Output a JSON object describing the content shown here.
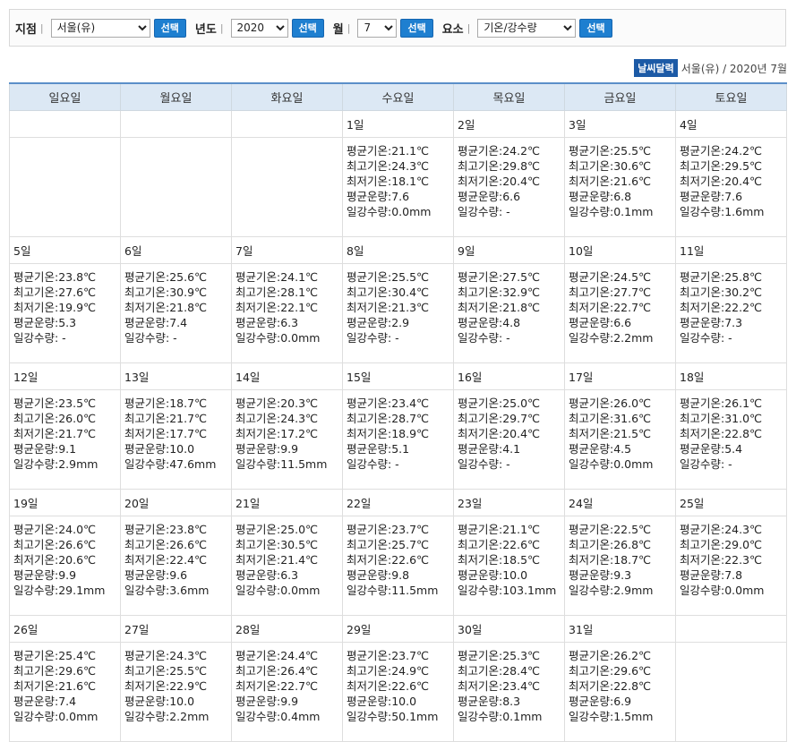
{
  "filters": {
    "station_label": "지점",
    "station_value": "서울(유)",
    "year_label": "년도",
    "year_value": "2020",
    "month_label": "월",
    "month_value": "7",
    "element_label": "요소",
    "element_value": "기온/강수량",
    "select_button": "선택"
  },
  "caption": {
    "badge": "날씨달력",
    "text": "서울(유) / 2020년 7월"
  },
  "calendar": {
    "weekdays": [
      "일요일",
      "월요일",
      "화요일",
      "수요일",
      "목요일",
      "금요일",
      "토요일"
    ],
    "weeks": [
      [
        null,
        null,
        null,
        {
          "day": "1일",
          "avg_temp": "평균기온:21.1℃",
          "max_temp": "최고기온:24.3℃",
          "min_temp": "최저기온:18.1℃",
          "cloud": "평균운량:7.6",
          "rain": "일강수량:0.0mm"
        },
        {
          "day": "2일",
          "avg_temp": "평균기온:24.2℃",
          "max_temp": "최고기온:29.8℃",
          "min_temp": "최저기온:20.4℃",
          "cloud": "평균운량:6.6",
          "rain": "일강수량: -"
        },
        {
          "day": "3일",
          "avg_temp": "평균기온:25.5℃",
          "max_temp": "최고기온:30.6℃",
          "min_temp": "최저기온:21.6℃",
          "cloud": "평균운량:6.8",
          "rain": "일강수량:0.1mm"
        },
        {
          "day": "4일",
          "avg_temp": "평균기온:24.2℃",
          "max_temp": "최고기온:29.5℃",
          "min_temp": "최저기온:20.4℃",
          "cloud": "평균운량:7.6",
          "rain": "일강수량:1.6mm"
        }
      ],
      [
        {
          "day": "5일",
          "avg_temp": "평균기온:23.8℃",
          "max_temp": "최고기온:27.6℃",
          "min_temp": "최저기온:19.9℃",
          "cloud": "평균운량:5.3",
          "rain": "일강수량: -"
        },
        {
          "day": "6일",
          "avg_temp": "평균기온:25.6℃",
          "max_temp": "최고기온:30.9℃",
          "min_temp": "최저기온:21.8℃",
          "cloud": "평균운량:7.4",
          "rain": "일강수량: -"
        },
        {
          "day": "7일",
          "avg_temp": "평균기온:24.1℃",
          "max_temp": "최고기온:28.1℃",
          "min_temp": "최저기온:22.1℃",
          "cloud": "평균운량:6.3",
          "rain": "일강수량:0.0mm"
        },
        {
          "day": "8일",
          "avg_temp": "평균기온:25.5℃",
          "max_temp": "최고기온:30.4℃",
          "min_temp": "최저기온:21.3℃",
          "cloud": "평균운량:2.9",
          "rain": "일강수량: -"
        },
        {
          "day": "9일",
          "avg_temp": "평균기온:27.5℃",
          "max_temp": "최고기온:32.9℃",
          "min_temp": "최저기온:21.8℃",
          "cloud": "평균운량:4.8",
          "rain": "일강수량: -"
        },
        {
          "day": "10일",
          "avg_temp": "평균기온:24.5℃",
          "max_temp": "최고기온:27.7℃",
          "min_temp": "최저기온:22.7℃",
          "cloud": "평균운량:6.6",
          "rain": "일강수량:2.2mm"
        },
        {
          "day": "11일",
          "avg_temp": "평균기온:25.8℃",
          "max_temp": "최고기온:30.2℃",
          "min_temp": "최저기온:22.2℃",
          "cloud": "평균운량:7.3",
          "rain": "일강수량: -"
        }
      ],
      [
        {
          "day": "12일",
          "avg_temp": "평균기온:23.5℃",
          "max_temp": "최고기온:26.0℃",
          "min_temp": "최저기온:21.7℃",
          "cloud": "평균운량:9.1",
          "rain": "일강수량:2.9mm"
        },
        {
          "day": "13일",
          "avg_temp": "평균기온:18.7℃",
          "max_temp": "최고기온:21.7℃",
          "min_temp": "최저기온:17.7℃",
          "cloud": "평균운량:10.0",
          "rain": "일강수량:47.6mm"
        },
        {
          "day": "14일",
          "avg_temp": "평균기온:20.3℃",
          "max_temp": "최고기온:24.3℃",
          "min_temp": "최저기온:17.2℃",
          "cloud": "평균운량:9.9",
          "rain": "일강수량:11.5mm"
        },
        {
          "day": "15일",
          "avg_temp": "평균기온:23.4℃",
          "max_temp": "최고기온:28.7℃",
          "min_temp": "최저기온:18.9℃",
          "cloud": "평균운량:5.1",
          "rain": "일강수량: -"
        },
        {
          "day": "16일",
          "avg_temp": "평균기온:25.0℃",
          "max_temp": "최고기온:29.7℃",
          "min_temp": "최저기온:20.4℃",
          "cloud": "평균운량:4.1",
          "rain": "일강수량: -"
        },
        {
          "day": "17일",
          "avg_temp": "평균기온:26.0℃",
          "max_temp": "최고기온:31.6℃",
          "min_temp": "최저기온:21.5℃",
          "cloud": "평균운량:4.5",
          "rain": "일강수량:0.0mm"
        },
        {
          "day": "18일",
          "avg_temp": "평균기온:26.1℃",
          "max_temp": "최고기온:31.0℃",
          "min_temp": "최저기온:22.8℃",
          "cloud": "평균운량:5.4",
          "rain": "일강수량: -"
        }
      ],
      [
        {
          "day": "19일",
          "avg_temp": "평균기온:24.0℃",
          "max_temp": "최고기온:26.6℃",
          "min_temp": "최저기온:20.6℃",
          "cloud": "평균운량:9.9",
          "rain": "일강수량:29.1mm"
        },
        {
          "day": "20일",
          "avg_temp": "평균기온:23.8℃",
          "max_temp": "최고기온:26.6℃",
          "min_temp": "최저기온:22.4℃",
          "cloud": "평균운량:9.6",
          "rain": "일강수량:3.6mm"
        },
        {
          "day": "21일",
          "avg_temp": "평균기온:25.0℃",
          "max_temp": "최고기온:30.5℃",
          "min_temp": "최저기온:21.4℃",
          "cloud": "평균운량:6.3",
          "rain": "일강수량:0.0mm"
        },
        {
          "day": "22일",
          "avg_temp": "평균기온:23.7℃",
          "max_temp": "최고기온:25.7℃",
          "min_temp": "최저기온:22.6℃",
          "cloud": "평균운량:9.8",
          "rain": "일강수량:11.5mm"
        },
        {
          "day": "23일",
          "avg_temp": "평균기온:21.1℃",
          "max_temp": "최고기온:22.6℃",
          "min_temp": "최저기온:18.5℃",
          "cloud": "평균운량:10.0",
          "rain": "일강수량:103.1mm"
        },
        {
          "day": "24일",
          "avg_temp": "평균기온:22.5℃",
          "max_temp": "최고기온:26.8℃",
          "min_temp": "최저기온:18.7℃",
          "cloud": "평균운량:9.3",
          "rain": "일강수량:2.9mm"
        },
        {
          "day": "25일",
          "avg_temp": "평균기온:24.3℃",
          "max_temp": "최고기온:29.0℃",
          "min_temp": "최저기온:22.3℃",
          "cloud": "평균운량:7.8",
          "rain": "일강수량:0.0mm"
        }
      ],
      [
        {
          "day": "26일",
          "avg_temp": "평균기온:25.4℃",
          "max_temp": "최고기온:29.6℃",
          "min_temp": "최저기온:21.6℃",
          "cloud": "평균운량:7.4",
          "rain": "일강수량:0.0mm"
        },
        {
          "day": "27일",
          "avg_temp": "평균기온:24.3℃",
          "max_temp": "최고기온:25.5℃",
          "min_temp": "최저기온:22.9℃",
          "cloud": "평균운량:10.0",
          "rain": "일강수량:2.2mm"
        },
        {
          "day": "28일",
          "avg_temp": "평균기온:24.4℃",
          "max_temp": "최고기온:26.4℃",
          "min_temp": "최저기온:22.7℃",
          "cloud": "평균운량:9.9",
          "rain": "일강수량:0.4mm"
        },
        {
          "day": "29일",
          "avg_temp": "평균기온:23.7℃",
          "max_temp": "최고기온:24.9℃",
          "min_temp": "최저기온:22.6℃",
          "cloud": "평균운량:10.0",
          "rain": "일강수량:50.1mm"
        },
        {
          "day": "30일",
          "avg_temp": "평균기온:25.3℃",
          "max_temp": "최고기온:28.4℃",
          "min_temp": "최저기온:23.4℃",
          "cloud": "평균운량:8.3",
          "rain": "일강수량:0.1mm"
        },
        {
          "day": "31일",
          "avg_temp": "평균기온:26.2℃",
          "max_temp": "최고기온:29.6℃",
          "min_temp": "최저기온:22.8℃",
          "cloud": "평균운량:6.9",
          "rain": "일강수량:1.5mm"
        },
        null
      ]
    ]
  }
}
